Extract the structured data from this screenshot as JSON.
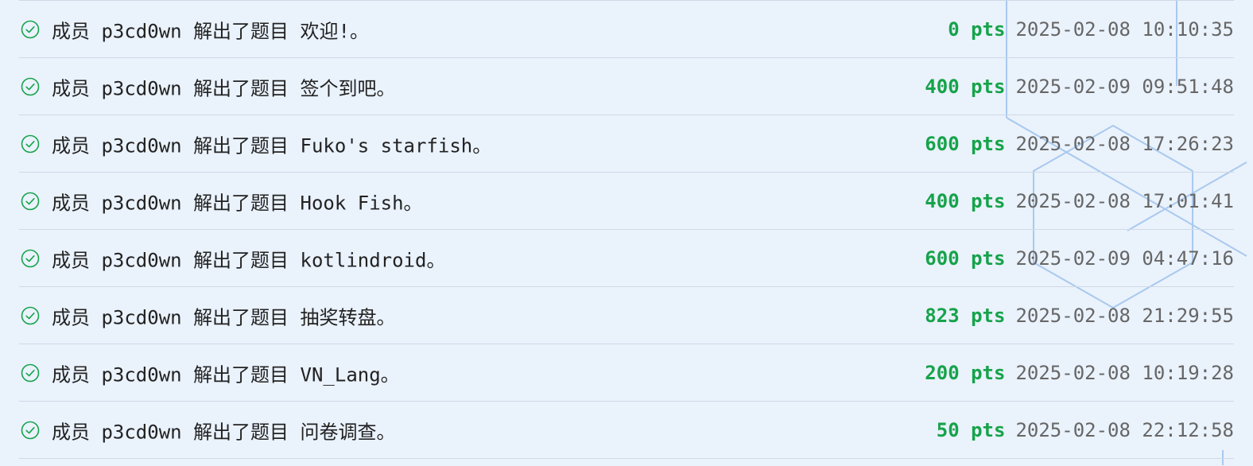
{
  "colors": {
    "background": "#eaf2fc",
    "accent_green": "#16a34a",
    "divider": "#cfd9e6",
    "text": "#222222",
    "timestamp": "#666666",
    "decor_lines": "#a9c9ee"
  },
  "solves": [
    {
      "icon": "check-circle-icon",
      "member_label": "成员",
      "member": "p3cd0wn",
      "action": "解出了题目",
      "challenge": "欢迎!。",
      "points": "0 pts",
      "time": "2025-02-08 10:10:35"
    },
    {
      "icon": "check-circle-icon",
      "member_label": "成员",
      "member": "p3cd0wn",
      "action": "解出了题目",
      "challenge": "签个到吧。",
      "points": "400 pts",
      "time": "2025-02-09 09:51:48"
    },
    {
      "icon": "check-circle-icon",
      "member_label": "成员",
      "member": "p3cd0wn",
      "action": "解出了题目",
      "challenge": "Fuko's starfish。",
      "points": "600 pts",
      "time": "2025-02-08 17:26:23"
    },
    {
      "icon": "check-circle-icon",
      "member_label": "成员",
      "member": "p3cd0wn",
      "action": "解出了题目",
      "challenge": "Hook Fish。",
      "points": "400 pts",
      "time": "2025-02-08 17:01:41"
    },
    {
      "icon": "check-circle-icon",
      "member_label": "成员",
      "member": "p3cd0wn",
      "action": "解出了题目",
      "challenge": "kotlindroid。",
      "points": "600 pts",
      "time": "2025-02-09 04:47:16"
    },
    {
      "icon": "check-circle-icon",
      "member_label": "成员",
      "member": "p3cd0wn",
      "action": "解出了题目",
      "challenge": "抽奖转盘。",
      "points": "823 pts",
      "time": "2025-02-08 21:29:55"
    },
    {
      "icon": "check-circle-icon",
      "member_label": "成员",
      "member": "p3cd0wn",
      "action": "解出了题目",
      "challenge": "VN_Lang。",
      "points": "200 pts",
      "time": "2025-02-08 10:19:28"
    },
    {
      "icon": "check-circle-icon",
      "member_label": "成员",
      "member": "p3cd0wn",
      "action": "解出了题目",
      "challenge": "问卷调查。",
      "points": "50 pts",
      "time": "2025-02-08 22:12:58"
    }
  ]
}
